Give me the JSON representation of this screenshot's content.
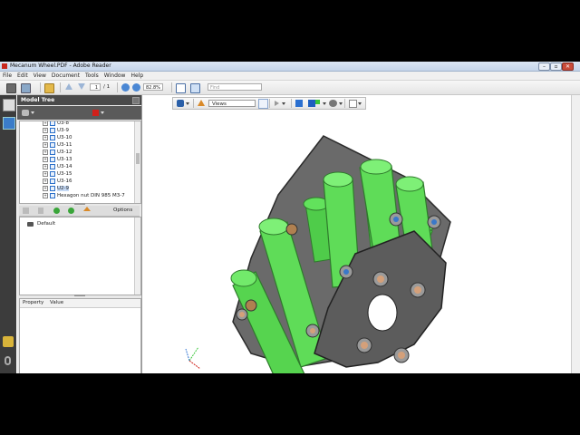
{
  "window": {
    "title": "Mecanum Wheel.PDF - Adobe Reader",
    "minimize_glyph": "–",
    "restore_glyph": "▫",
    "close_glyph": "✕"
  },
  "menu": [
    "File",
    "Edit",
    "View",
    "Document",
    "Tools",
    "Window",
    "Help"
  ],
  "toolbar": {
    "page_current": "1",
    "page_total": "/ 1",
    "zoom": "82.8%",
    "find_placeholder": "Find"
  },
  "viewer_toolbar": {
    "views_label": "Views"
  },
  "model_tree": {
    "title": "Model Tree",
    "items": [
      "U3-8",
      "U3-9",
      "U3-10",
      "U3-11",
      "U3-12",
      "U3-13",
      "U3-14",
      "U3-15",
      "U3-16",
      "U2-9",
      "Hexagon nut DIN 985 M3-7"
    ],
    "selected_index": 9
  },
  "views_panel": {
    "options_label": "Options",
    "items": [
      "Default"
    ]
  },
  "properties": {
    "col_property": "Property",
    "col_value": "Value"
  },
  "colors": {
    "roller_green": "#62e25c",
    "plate_gray": "#5c5c5c",
    "accent_red": "#d0201a"
  }
}
